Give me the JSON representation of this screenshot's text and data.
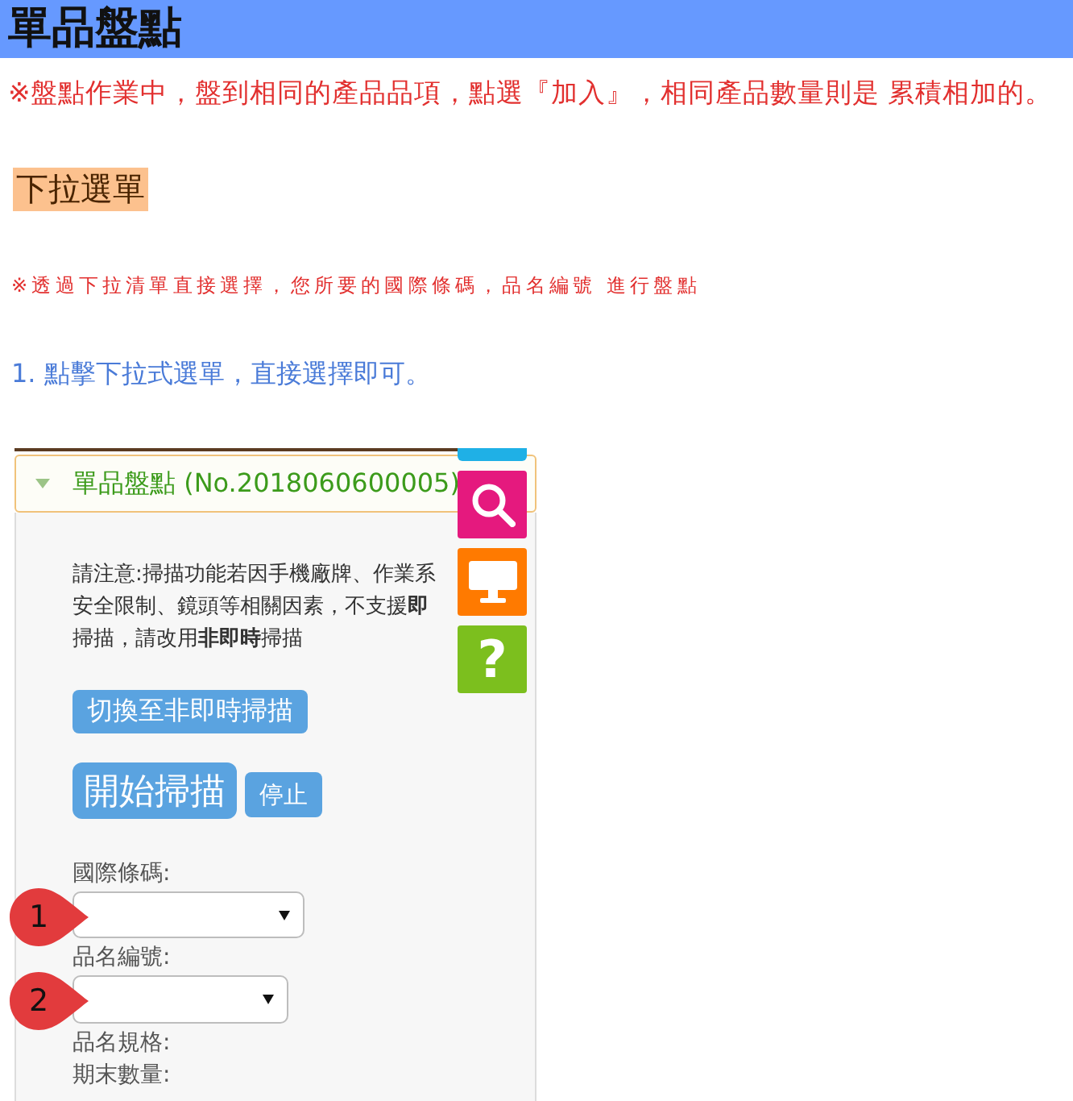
{
  "header": {
    "title": "單品盤點"
  },
  "notice": "※盤點作業中，盤到相同的產品品項，點選『加入』，相同產品數量則是 累積相加的。",
  "section": {
    "heading": "下拉選單",
    "note": "※透過下拉清單直接選擇，您所要的國際條碼，品名編號 進行盤點",
    "step": "1. 點擊下拉式選單，直接選擇即可。"
  },
  "screenshot": {
    "panel": {
      "title": "單品盤點 (No.2018060600005)",
      "expanded": true,
      "notice_lines": [
        "請注意:掃描功能若因手機廠牌、作業系",
        "安全限制、鏡頭等相關因素，不支援**即**",
        "掃描，請改用**非即時**掃描"
      ],
      "button_rows": [
        [
          {
            "label": "切換至非即時掃描",
            "kind": "toggle"
          }
        ],
        [
          {
            "label": "開始掃描",
            "kind": "start"
          },
          {
            "label": "停止",
            "kind": "stop"
          }
        ]
      ],
      "fields": [
        {
          "label": "國際條碼:",
          "kind": "select",
          "callout": "1"
        },
        {
          "label": "品名編號:",
          "kind": "select",
          "callout": "2"
        },
        {
          "label": "品名規格:",
          "kind": "text"
        },
        {
          "label": "期末數量:",
          "kind": "text"
        }
      ]
    },
    "side_toolbar": [
      {
        "kind": "partial",
        "color": "#1fb0e6"
      },
      {
        "kind": "search",
        "color": "#e5197e"
      },
      {
        "kind": "monitor",
        "color": "#ff7a00"
      },
      {
        "kind": "help",
        "symbol": "?",
        "color": "#7cbf1e"
      }
    ]
  }
}
